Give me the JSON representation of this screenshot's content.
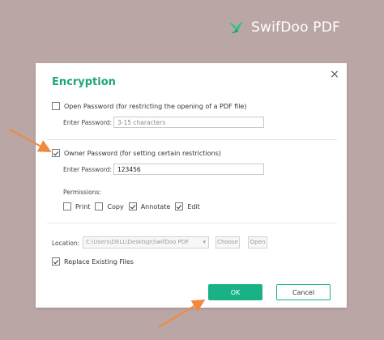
{
  "brand": {
    "name": "SwifDoo PDF",
    "logo_icon": "swift-bird-icon"
  },
  "dialog": {
    "title": "Encryption",
    "close_glyph": "×",
    "open_password": {
      "checkbox_label": "Open Password (for restricting the opening of a PDF file)",
      "checked": false,
      "field_label": "Enter Password:",
      "placeholder": "3-15 characters",
      "value": ""
    },
    "owner_password": {
      "checkbox_label": "Owner Password (for setting certain restrictions)",
      "checked": true,
      "field_label": "Enter Password:",
      "value": "123456"
    },
    "permissions": {
      "label": "Permissions:",
      "items": [
        {
          "label": "Print",
          "checked": false
        },
        {
          "label": "Copy",
          "checked": false
        },
        {
          "label": "Annotate",
          "checked": true
        },
        {
          "label": "Edit",
          "checked": true
        }
      ]
    },
    "location": {
      "label": "Location:",
      "value": "C:\\Users\\DELL\\Desktop\\SwifDoo PDF",
      "choose_label": "Choose",
      "open_label": "Open"
    },
    "replace_existing": {
      "label": "Replace Existing Files",
      "checked": true
    },
    "buttons": {
      "ok": "OK",
      "cancel": "Cancel"
    }
  },
  "colors": {
    "accent": "#19b286",
    "title": "#1fa57a",
    "background": "#b9a6a5",
    "annotation_arrow": "#f08a3c"
  }
}
